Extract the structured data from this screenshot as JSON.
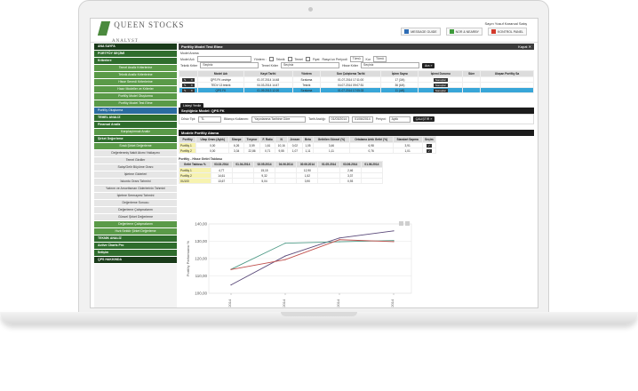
{
  "header": {
    "logo_text": "QUEEN STOCKS",
    "logo_sub": "ANALYST",
    "top_right_text": "Sayın Yusuf Karanıal Satış",
    "top_buttons": [
      {
        "label": "MESSAGE GUIDE",
        "color": "#2f6db5"
      },
      {
        "label": "NOR & NEARBY",
        "color": "#3d9a3a"
      },
      {
        "label": "KONTROL PANEL",
        "color": "#d33b2c"
      }
    ]
  },
  "sidebar": {
    "items": [
      {
        "label": "ANA SAYFA",
        "kind": "main"
      },
      {
        "label": "PORTFÖY SEÇİMİ",
        "kind": "section"
      },
      {
        "label": "Kriterlere",
        "kind": "section"
      },
      {
        "label": "Temel Analiz Kriterlerine",
        "kind": "sub"
      },
      {
        "label": "Teknik Analiz Kriterlerine",
        "kind": "sub"
      },
      {
        "label": "Hisse Senedi Kriterlerine",
        "kind": "sub"
      },
      {
        "label": "Hazır Modeller ve Kriterler",
        "kind": "sub"
      },
      {
        "label": "Portföy Model Oluşturma",
        "kind": "sub"
      },
      {
        "label": "Portföy Model Test Etme",
        "kind": "sub"
      },
      {
        "label": "Portföy Oluşturma",
        "kind": "active"
      },
      {
        "label": "TEMEL ANALİZ",
        "kind": "section"
      },
      {
        "label": "Finansal Analiz",
        "kind": "section"
      },
      {
        "label": "Karşılaştırmalı Analiz",
        "kind": "sub"
      },
      {
        "label": "Şirket Değerleme",
        "kind": "section"
      },
      {
        "label": "Sıralı Şirket Değerleme",
        "kind": "sub"
      },
      {
        "label": "Değerlenmiş Nakit Akımı Yaklaşımı",
        "kind": "light"
      },
      {
        "label": "Temel Girdiler",
        "kind": "light"
      },
      {
        "label": "Satış/Gelir Büyüme Oranı",
        "kind": "light"
      },
      {
        "label": "İşletme Giderleri",
        "kind": "light"
      },
      {
        "label": "İskonto Oranı Tahmini",
        "kind": "light"
      },
      {
        "label": "Yatırım ve Amortisman Giderlerinin Tahmini",
        "kind": "light"
      },
      {
        "label": "İşletme Sermayesi Tahmini",
        "kind": "light"
      },
      {
        "label": "Değerleme Sonucu",
        "kind": "light"
      },
      {
        "label": "Değerleme Çalışmalarım",
        "kind": "light"
      },
      {
        "label": "Güncel Şirket Değerleme",
        "kind": "light"
      },
      {
        "label": "Değerleme Çalışmalarım",
        "kind": "sub"
      },
      {
        "label": "Hızlı Sektör Şirket Değerleme",
        "kind": "sub"
      },
      {
        "label": "TEKNİK ANALİZ",
        "kind": "section"
      },
      {
        "label": "Active Charts Pro",
        "kind": "section"
      },
      {
        "label": "İletişim",
        "kind": "section"
      },
      {
        "label": "QPS HAKKINDA",
        "kind": "main"
      }
    ]
  },
  "model_test": {
    "title": "Portföy Model Test Etme",
    "close_label": "Kapat",
    "search_label": "Model Arama",
    "model_adi_label": "Model Adı",
    "yontem_label": "Yöntem :",
    "opts": [
      "Teknik",
      "Temel",
      "Fiyat"
    ],
    "rebalance_label": "Rasyo'un Periyodi",
    "rebalance_value": "Tümü",
    "kur_label": "Kur",
    "kur_value": "Tümü",
    "teknik_kriter_label": "Teknik Kriter",
    "teknik_kriter_value": "Seçiniz",
    "temel_kriter_label": "Temel Kriter",
    "temel_kriter_value": "Seçiniz",
    "hisse_kriter_label": "Hisse Kriter",
    "hisse_kriter_value": "Seçiniz",
    "search_button": "Ara",
    "columns": [
      "",
      "Model Adı",
      "Kayıt Tarihi",
      "Yöntem",
      "Son Çalıştırma Tarihi",
      "İşlem Sayısı",
      "İşlemi Durumu",
      "Süre",
      "Ulaşan Portföy Sa"
    ],
    "rows": [
      {
        "name": "QPS FK cevkiye",
        "date": "01.07.2014 14:48",
        "method": "Sıralama",
        "last": "01.07.2014 17:11:00",
        "count": "17 (3/4)",
        "status": "Sonuçlar",
        "hl": false
      },
      {
        "name": "TEDV 13 teknik",
        "date": "04.03.2014 14:47",
        "method": "Teknik",
        "last": "04.07.2014 09:07:51",
        "count": "36 (6/4)",
        "status": "Sonuçlar",
        "hl": false
      },
      {
        "name": "QPS FK",
        "date": "01.09.2013 12:20",
        "method": "Sıralama",
        "last": "01.07.2014 17:05:33",
        "count": "11 (4/6)",
        "status": "Sonuçlar",
        "hl": true
      }
    ],
    "load_button": "Listeyi Yenile"
  },
  "selected_model": {
    "title": "Seçtiğiniz Model: QPS FK",
    "para_birimi_label": "Döviz Tipi:",
    "para_birimi_value": "TL",
    "bilanco_label": "Bilanço Kullanımı:",
    "bilanco_value": "Yayınlanma Tarihine Göre",
    "start_label": "Tarih Aralığı:",
    "start_value": "01/03/2014",
    "end_value": "01/06/2014",
    "periyot_label": "Periyot:",
    "periyot_value": "Aylık",
    "run_button": "ÇALIŞTIR"
  },
  "allocation": {
    "title": "Modele Portföy Atama",
    "columns": [
      "Portföy",
      "Ulaşı Oranı (Aylık)",
      "Sharpe",
      "Treynor",
      "F. Ratio",
      "N",
      "Jensen",
      "Beta",
      "Getirilen Günsel (%)",
      "Ortalama Artık Getiri (%)",
      "Standart Sapma",
      "Seçim"
    ],
    "rows": [
      [
        "Portföy 1",
        "0,00",
        "6,26",
        "3,59",
        "1,61",
        "10,16",
        "0,02",
        "1,05",
        "3,46",
        "6,98",
        "3,91",
        ""
      ],
      [
        "Portföy 2",
        "0,00",
        "3,34",
        "22,86",
        "0,71",
        "9,55",
        "1,07",
        "1,11",
        "1,11",
        "0,76",
        "1,01",
        ""
      ]
    ]
  },
  "returns": {
    "title": "Portföy - Hisse Getiri Tablosu",
    "columns": [
      "Getiri Tablosu %",
      "03.03.2014",
      "01.04.2014",
      "02.05.2014",
      "04.06.2014",
      "30.06.2014",
      "01.05.2014",
      "03.06.2014",
      "01.06.2014"
    ],
    "rows": [
      [
        "Portföy 1",
        "4,77",
        "",
        "15,15",
        "",
        "12,90",
        "",
        "2,46",
        ""
      ],
      [
        "Portföy 2",
        "14,61",
        "",
        "9,32",
        "",
        "1,52",
        "",
        "3,37",
        ""
      ],
      [
        "XU100",
        "13,67",
        "",
        "5,04",
        "",
        "3,90",
        "",
        "0,93",
        ""
      ]
    ]
  },
  "chart_data": {
    "type": "line",
    "title": "",
    "xlabel": "",
    "ylabel": "Portföy Performansı %",
    "categories": [
      "03.2014",
      "04.2014",
      "05.2014",
      "06.2014"
    ],
    "series": [
      {
        "name": "Portföy1",
        "color": "#5b4a7a",
        "values": [
          104.8,
          121.5,
          131.9,
          136.0
        ]
      },
      {
        "name": "Portföy2",
        "color": "#4e9a86",
        "values": [
          113.8,
          128.9,
          129.7,
          130.4
        ]
      },
      {
        "name": "XU100",
        "color": "#c0504d",
        "values": [
          113.7,
          119.4,
          130.9,
          129.8
        ]
      }
    ],
    "ylim": [
      100,
      140
    ],
    "yticks": [
      "100,00",
      "110,00",
      "120,00",
      "130,00",
      "140,00"
    ],
    "grid": true,
    "legend": "bottom"
  }
}
